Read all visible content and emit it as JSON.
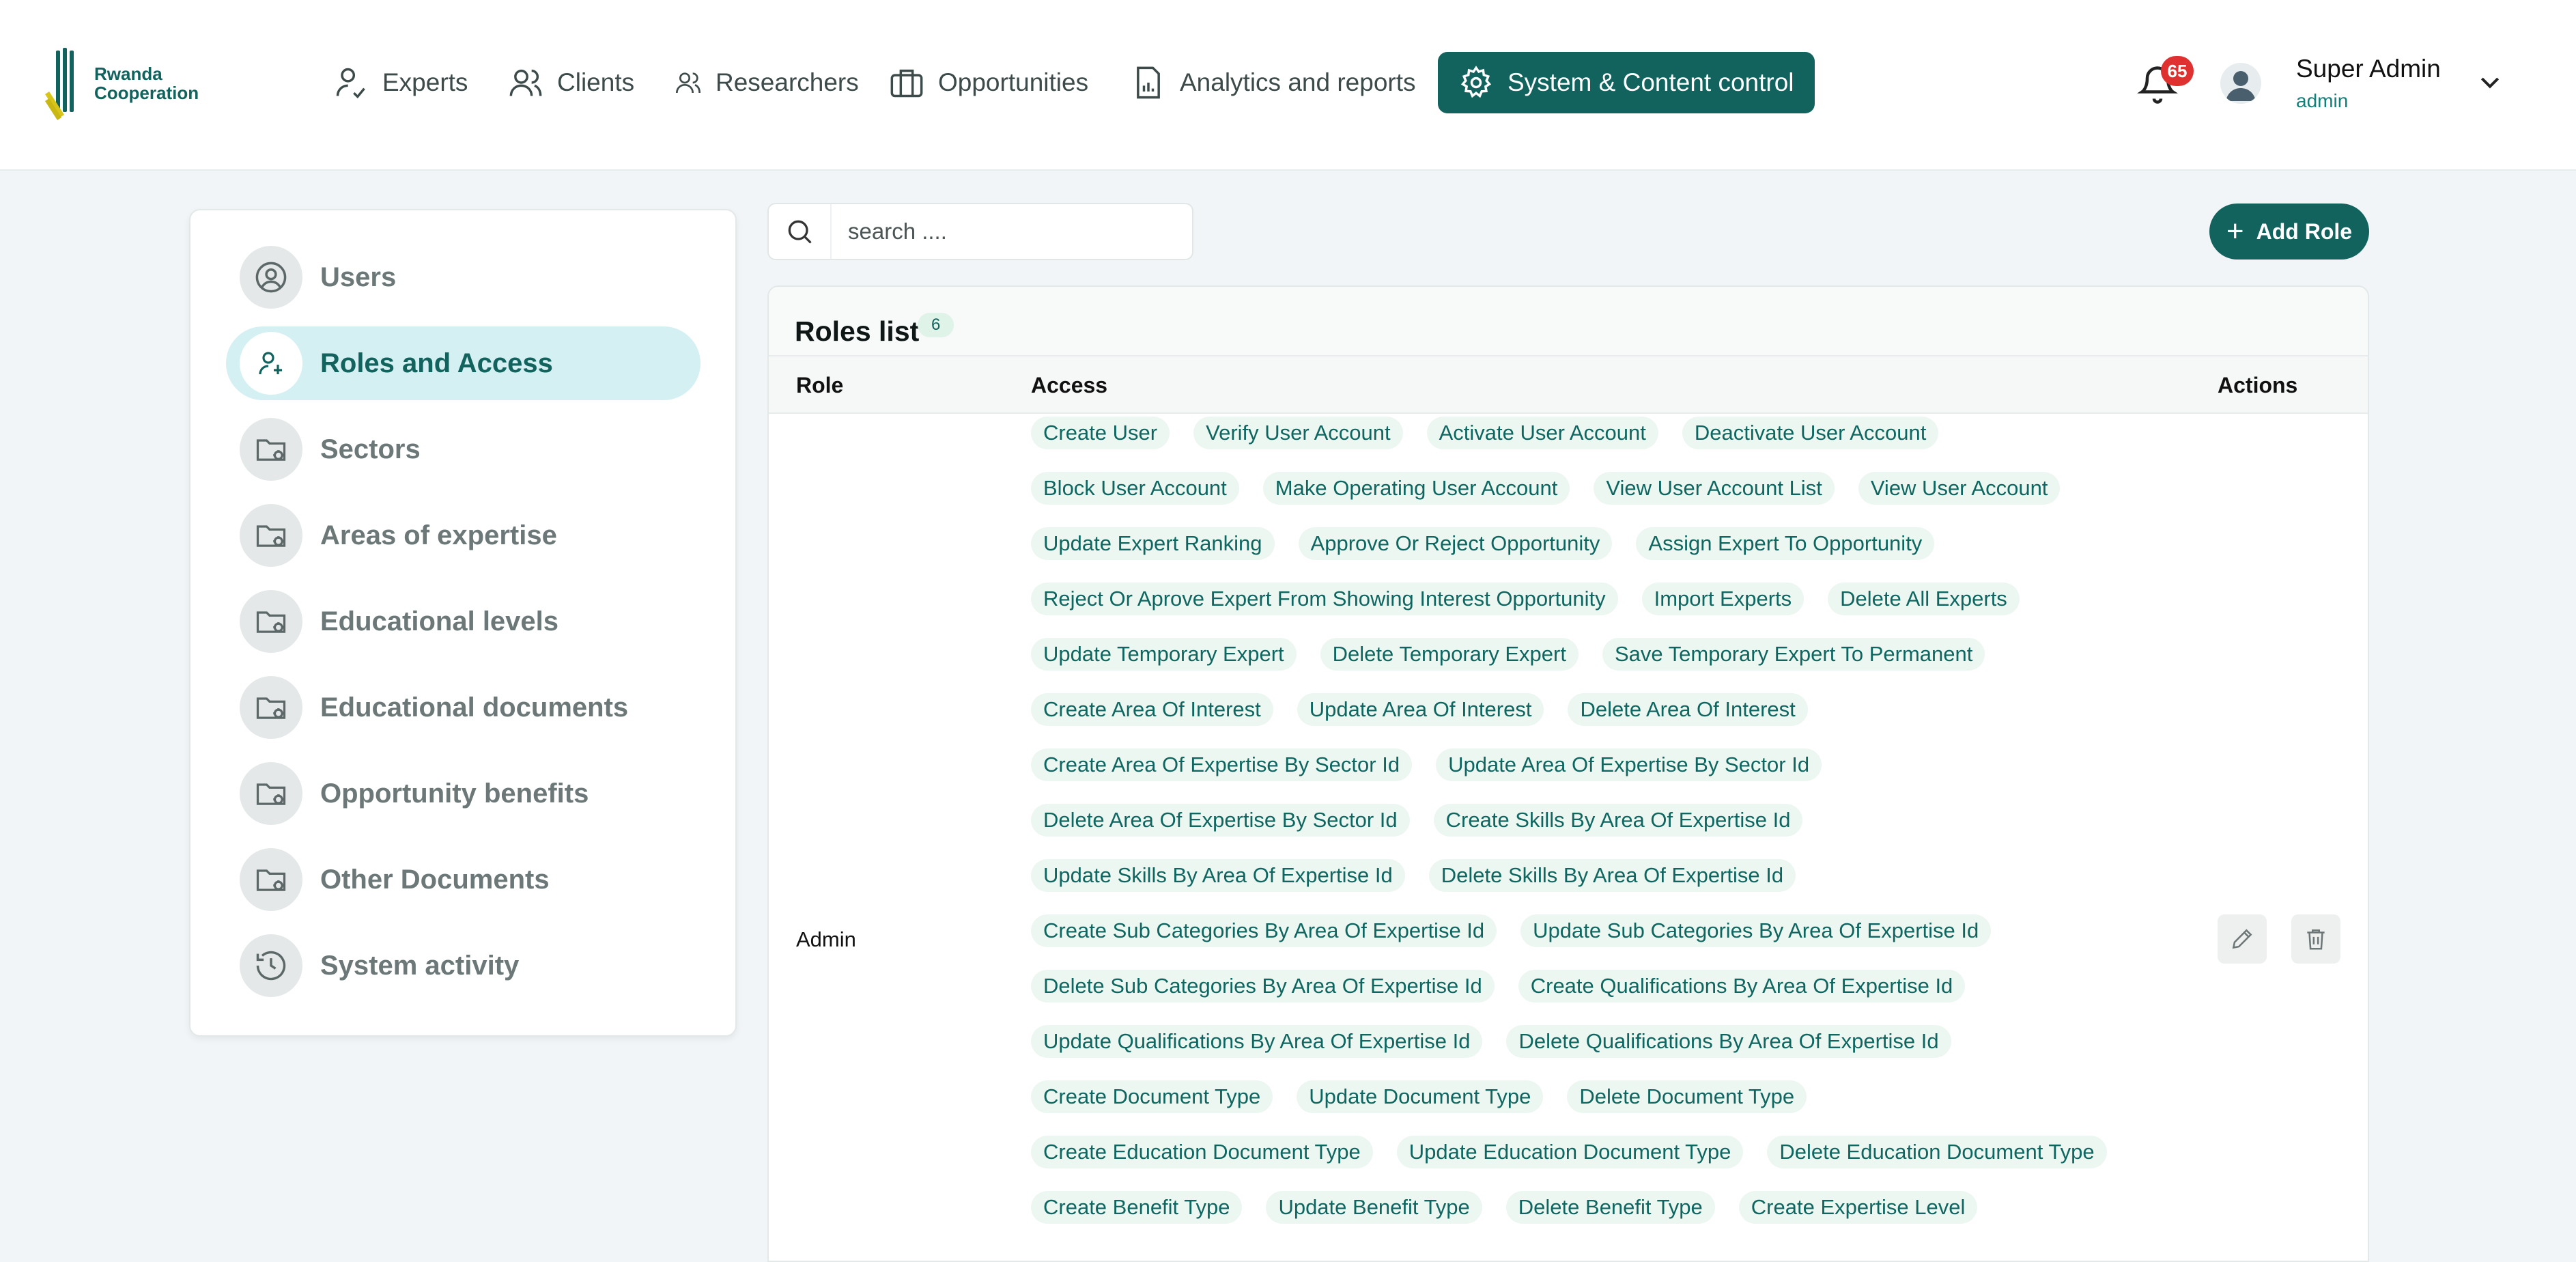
{
  "brand": {
    "line1": "Rwanda",
    "line2": "Cooperation"
  },
  "nav": [
    {
      "label": "Experts",
      "icon": "user-check-icon"
    },
    {
      "label": "Clients",
      "icon": "users-icon"
    },
    {
      "label": "Researchers",
      "icon": "users-small-icon"
    },
    {
      "label": "Opportunities",
      "icon": "briefcase-icon"
    },
    {
      "label": "Analytics and reports",
      "icon": "report-icon"
    },
    {
      "label": "System & Content control",
      "icon": "gear-icon",
      "active": true
    }
  ],
  "header": {
    "notifications_count": "65",
    "user_name": "Super Admin",
    "user_role": "admin"
  },
  "sidebar": {
    "items": [
      {
        "label": "Users",
        "icon": "user-circle-icon"
      },
      {
        "label": "Roles and Access",
        "icon": "user-key-icon",
        "active": true
      },
      {
        "label": "Sectors",
        "icon": "folder-gear-icon"
      },
      {
        "label": "Areas of expertise",
        "icon": "folder-gear-icon"
      },
      {
        "label": "Educational levels",
        "icon": "folder-gear-icon"
      },
      {
        "label": "Educational documents",
        "icon": "folder-gear-icon"
      },
      {
        "label": "Opportunity benefits",
        "icon": "folder-gear-icon"
      },
      {
        "label": "Other Documents",
        "icon": "folder-gear-icon"
      },
      {
        "label": "System activity",
        "icon": "history-icon"
      }
    ]
  },
  "search": {
    "placeholder": "search ...."
  },
  "add_role_label": "Add Role",
  "roles": {
    "title": "Roles list",
    "count": "6",
    "columns": {
      "role": "Role",
      "access": "Access",
      "actions": "Actions"
    },
    "rows": [
      {
        "role": "Admin",
        "access": [
          [
            "Create User",
            "Verify User Account",
            "Activate User Account",
            "Deactivate User Account"
          ],
          [
            "Block User Account",
            "Make Operating User Account",
            "View User Account List",
            "View User Account"
          ],
          [
            "Update Expert Ranking",
            "Approve Or Reject Opportunity",
            "Assign Expert To Opportunity"
          ],
          [
            "Reject Or Aprove Expert From Showing Interest Opportunity",
            "Import Experts",
            "Delete All Experts"
          ],
          [
            "Update Temporary Expert",
            "Delete Temporary Expert",
            "Save Temporary Expert To Permanent"
          ],
          [
            "Create Area Of Interest",
            "Update Area Of Interest",
            "Delete Area Of Interest"
          ],
          [
            "Create Area Of Expertise By Sector Id",
            "Update Area Of Expertise By Sector Id"
          ],
          [
            "Delete Area Of Expertise By Sector Id",
            "Create Skills By Area Of Expertise Id"
          ],
          [
            "Update Skills By Area Of Expertise Id",
            "Delete Skills By Area Of Expertise Id"
          ],
          [
            "Create Sub Categories By Area Of Expertise Id",
            "Update Sub Categories By Area Of Expertise Id"
          ],
          [
            "Delete Sub Categories By Area Of Expertise Id",
            "Create Qualifications By Area Of Expertise Id"
          ],
          [
            "Update Qualifications By Area Of Expertise Id",
            "Delete Qualifications By Area Of Expertise Id"
          ],
          [
            "Create Document Type",
            "Update Document Type",
            "Delete Document Type"
          ],
          [
            "Create Education Document Type",
            "Update Education Document Type",
            "Delete Education Document Type"
          ],
          [
            "Create Benefit Type",
            "Update Benefit Type",
            "Delete Benefit Type",
            "Create Expertise Level"
          ]
        ]
      }
    ]
  }
}
